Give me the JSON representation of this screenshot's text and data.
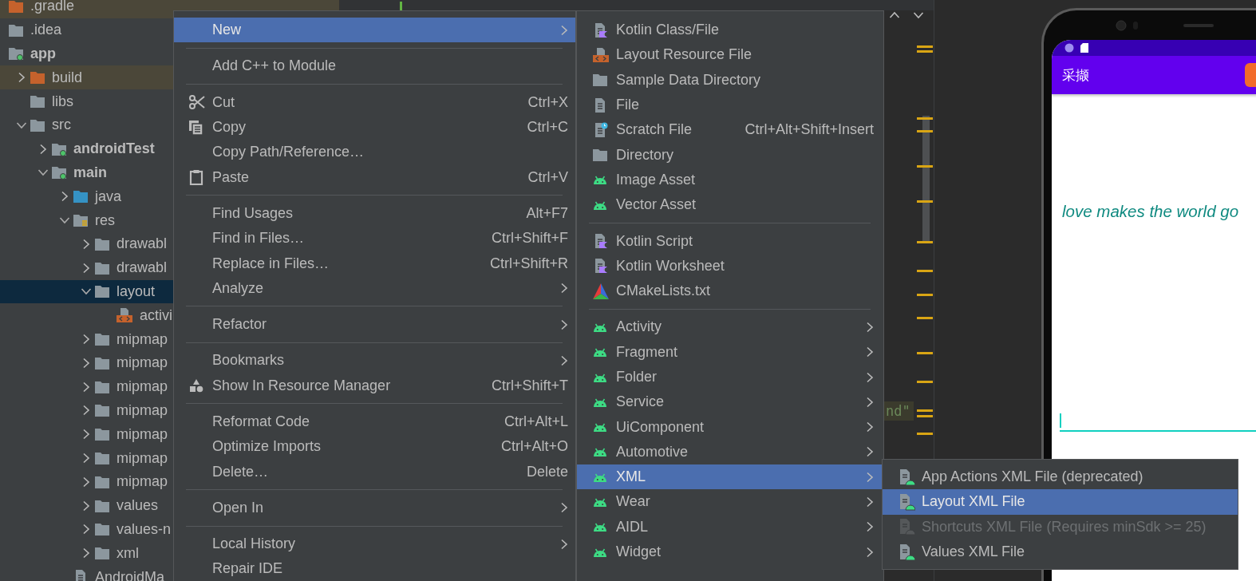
{
  "project_tree": {
    "items": [
      {
        "kind": "excluded",
        "label": ".gradle",
        "selected": false
      },
      {
        "kind": "folder",
        "label": ".idea",
        "selected": false
      },
      {
        "kind": "module",
        "label": "app",
        "selected": false,
        "bold": true,
        "children": [
          {
            "kind": "excluded",
            "label": "build",
            "expanded": false,
            "selected": false
          },
          {
            "kind": "folder",
            "label": "libs",
            "selected": false
          },
          {
            "kind": "folder",
            "label": "src",
            "expanded": true,
            "selected": false,
            "children": [
              {
                "kind": "module",
                "label": "androidTest",
                "bold": true,
                "expanded": false,
                "selected": false
              },
              {
                "kind": "module",
                "label": "main",
                "bold": true,
                "expanded": true,
                "selected": false,
                "children": [
                  {
                    "kind": "source",
                    "label": "java",
                    "expanded": false,
                    "selected": false
                  },
                  {
                    "kind": "res",
                    "label": "res",
                    "expanded": true,
                    "selected": false,
                    "children": [
                      {
                        "kind": "folder",
                        "label": "drawabl",
                        "expanded": false,
                        "selected": false
                      },
                      {
                        "kind": "folder",
                        "label": "drawabl",
                        "expanded": false,
                        "selected": false
                      },
                      {
                        "kind": "folder",
                        "label": "layout",
                        "expanded": true,
                        "selected": true,
                        "children": [
                          {
                            "kind": "layout",
                            "label": "activi",
                            "selected": false
                          }
                        ]
                      },
                      {
                        "kind": "folder",
                        "label": "mipmap",
                        "expanded": false,
                        "selected": false
                      },
                      {
                        "kind": "folder",
                        "label": "mipmap",
                        "expanded": false,
                        "selected": false
                      },
                      {
                        "kind": "folder",
                        "label": "mipmap",
                        "expanded": false,
                        "selected": false
                      },
                      {
                        "kind": "folder",
                        "label": "mipmap",
                        "expanded": false,
                        "selected": false
                      },
                      {
                        "kind": "folder",
                        "label": "mipmap",
                        "expanded": false,
                        "selected": false
                      },
                      {
                        "kind": "folder",
                        "label": "mipmap",
                        "expanded": false,
                        "selected": false
                      },
                      {
                        "kind": "folder",
                        "label": "mipmap",
                        "expanded": false,
                        "selected": false
                      },
                      {
                        "kind": "folder",
                        "label": "values",
                        "expanded": false,
                        "selected": false
                      },
                      {
                        "kind": "folder",
                        "label": "values-n",
                        "expanded": false,
                        "selected": false
                      },
                      {
                        "kind": "folder",
                        "label": "xml",
                        "expanded": false,
                        "selected": false
                      }
                    ]
                  },
                  {
                    "kind": "manifest",
                    "label": "AndroidMa",
                    "selected": false
                  }
                ]
              }
            ]
          }
        ]
      }
    ]
  },
  "editor": {
    "code_fragment": "nd\""
  },
  "preview": {
    "app_title": "采撷",
    "text": "love makes the world go"
  },
  "context_menu": {
    "items": [
      {
        "kind": "plain",
        "label": "New",
        "submenu": true,
        "selected": true
      },
      {
        "kind": "separator"
      },
      {
        "kind": "plain",
        "label": "Add C++ to Module",
        "selected": false
      },
      {
        "kind": "separator"
      },
      {
        "kind": "scissors",
        "label": "Cut",
        "shortcut": "Ctrl+X",
        "selected": false
      },
      {
        "kind": "copy",
        "label": "Copy",
        "shortcut": "Ctrl+C",
        "selected": false
      },
      {
        "kind": "plain",
        "label": "Copy Path/Reference…",
        "selected": false
      },
      {
        "kind": "clipboard",
        "label": "Paste",
        "shortcut": "Ctrl+V",
        "selected": false
      },
      {
        "kind": "separator"
      },
      {
        "kind": "plain",
        "label": "Find Usages",
        "shortcut": "Alt+F7",
        "selected": false
      },
      {
        "kind": "plain",
        "label": "Find in Files…",
        "shortcut": "Ctrl+Shift+F",
        "selected": false
      },
      {
        "kind": "plain",
        "label": "Replace in Files…",
        "shortcut": "Ctrl+Shift+R",
        "selected": false
      },
      {
        "kind": "plain",
        "label": "Analyze",
        "submenu": true,
        "selected": false
      },
      {
        "kind": "separator"
      },
      {
        "kind": "plain",
        "label": "Refactor",
        "submenu": true,
        "selected": false
      },
      {
        "kind": "separator"
      },
      {
        "kind": "plain",
        "label": "Bookmarks",
        "submenu": true,
        "selected": false
      },
      {
        "kind": "shapes",
        "label": "Show In Resource Manager",
        "shortcut": "Ctrl+Shift+T",
        "selected": false
      },
      {
        "kind": "separator"
      },
      {
        "kind": "plain",
        "label": "Reformat Code",
        "shortcut": "Ctrl+Alt+L",
        "selected": false
      },
      {
        "kind": "plain",
        "label": "Optimize Imports",
        "shortcut": "Ctrl+Alt+O",
        "selected": false
      },
      {
        "kind": "plain",
        "label": "Delete…",
        "shortcut": "Delete",
        "selected": false
      },
      {
        "kind": "separator"
      },
      {
        "kind": "plain",
        "label": "Open In",
        "submenu": true,
        "selected": false
      },
      {
        "kind": "separator"
      },
      {
        "kind": "plain",
        "label": "Local History",
        "submenu": true,
        "selected": false
      },
      {
        "kind": "plain",
        "label": "Repair IDE",
        "selected": false
      }
    ]
  },
  "new_submenu": {
    "items": [
      {
        "kind": "kotlin",
        "label": "Kotlin Class/File",
        "selected": false
      },
      {
        "kind": "layout",
        "label": "Layout Resource File",
        "selected": false
      },
      {
        "kind": "folder",
        "label": "Sample Data Directory",
        "selected": false
      },
      {
        "kind": "file",
        "label": "File",
        "selected": false
      },
      {
        "kind": "scratch",
        "label": "Scratch File",
        "shortcut": "Ctrl+Alt+Shift+Insert",
        "selected": false
      },
      {
        "kind": "folder",
        "label": "Directory",
        "selected": false
      },
      {
        "kind": "android",
        "label": "Image Asset",
        "selected": false
      },
      {
        "kind": "android",
        "label": "Vector Asset",
        "selected": false
      },
      {
        "kind": "separator"
      },
      {
        "kind": "kotlin",
        "label": "Kotlin Script",
        "selected": false
      },
      {
        "kind": "kotlin",
        "label": "Kotlin Worksheet",
        "selected": false
      },
      {
        "kind": "cmake",
        "label": "CMakeLists.txt",
        "selected": false
      },
      {
        "kind": "separator"
      },
      {
        "kind": "android",
        "label": "Activity",
        "submenu": true,
        "selected": false
      },
      {
        "kind": "android",
        "label": "Fragment",
        "submenu": true,
        "selected": false
      },
      {
        "kind": "android",
        "label": "Folder",
        "submenu": true,
        "selected": false
      },
      {
        "kind": "android",
        "label": "Service",
        "submenu": true,
        "selected": false
      },
      {
        "kind": "android",
        "label": "UiComponent",
        "submenu": true,
        "selected": false
      },
      {
        "kind": "android",
        "label": "Automotive",
        "submenu": true,
        "selected": false
      },
      {
        "kind": "android",
        "label": "XML",
        "submenu": true,
        "selected": true
      },
      {
        "kind": "android",
        "label": "Wear",
        "submenu": true,
        "selected": false
      },
      {
        "kind": "android",
        "label": "AIDL",
        "submenu": true,
        "selected": false
      },
      {
        "kind": "android",
        "label": "Widget",
        "submenu": true,
        "selected": false
      }
    ]
  },
  "xml_submenu": {
    "items": [
      {
        "kind": "xml",
        "label": "App Actions XML File (deprecated)",
        "selected": false,
        "disabled": false
      },
      {
        "kind": "xml",
        "label": "Layout XML File",
        "selected": true,
        "disabled": false
      },
      {
        "kind": "xml",
        "label": "Shortcuts XML File (Requires minSdk >= 25)",
        "selected": false,
        "disabled": true
      },
      {
        "kind": "xml",
        "label": "Values XML File",
        "selected": false,
        "disabled": false
      }
    ]
  }
}
